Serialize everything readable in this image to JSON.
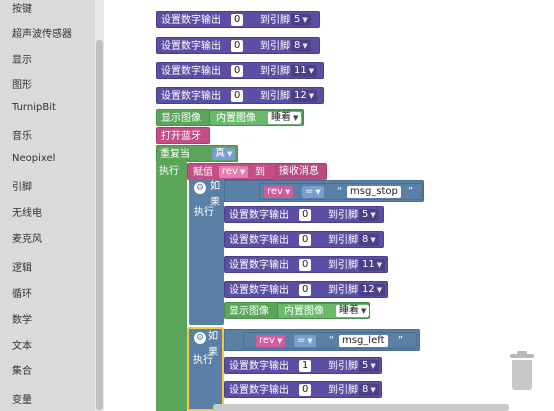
{
  "sidebar": {
    "items": [
      "按键",
      "超声波传感器",
      "显示",
      "图形",
      "TurnipBit",
      "音乐",
      "Neopixel",
      "引脚",
      "无线电",
      "麦克风",
      "逻辑",
      "循环",
      "数学",
      "文本",
      "集合",
      "变量"
    ]
  },
  "blocks": {
    "set_digital": "设置数字输出",
    "to_pin": "到引脚",
    "val0": "0",
    "val1": "1",
    "pin5": "5",
    "pin8": "8",
    "pin11": "11",
    "pin12": "12",
    "show_image": "显示图像",
    "builtin_image": "内置图像",
    "sleep": "睡着",
    "open_bt": "打开蓝牙",
    "repeat_while": "重复当",
    "true": "真",
    "execute": "执行",
    "assign": "赋值",
    "var_rev": "rev",
    "to": "到",
    "receive_msg": "接收消息",
    "if": "如果",
    "eq": "=",
    "msg_stop": "msg_stop",
    "msg_left": "msg_left",
    "quote_open": "“",
    "quote_close": "”"
  },
  "colors": {
    "purple": "#5b4fa3",
    "green": "#5ba55b",
    "pink": "#c44f86",
    "blue": "#5b80a5",
    "highlight": "#f2c94c"
  }
}
